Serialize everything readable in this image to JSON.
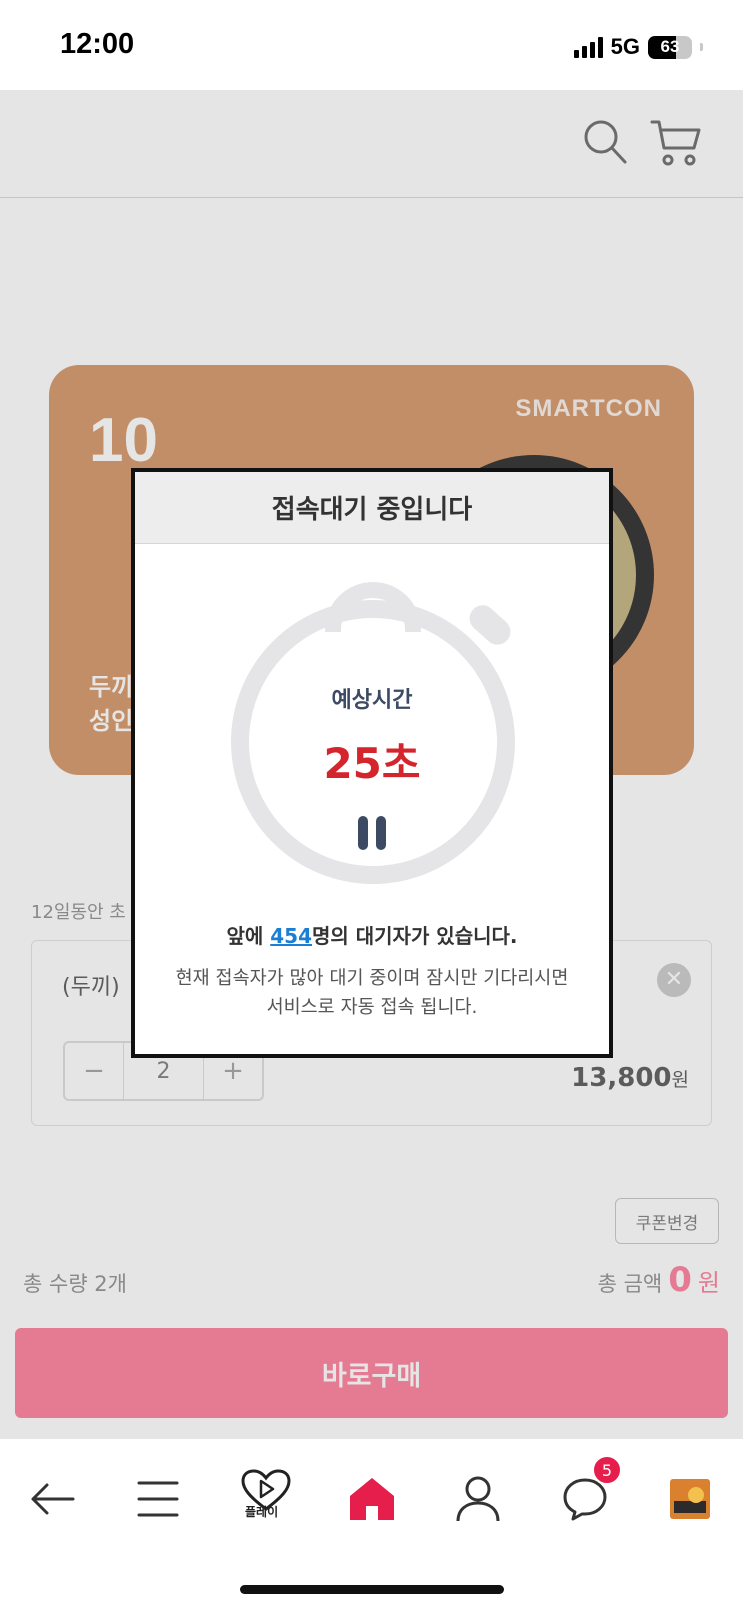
{
  "status_bar": {
    "time": "12:00",
    "network": "5G",
    "battery": "63",
    "battery_level": 0.63
  },
  "header": {
    "icons": [
      "search-icon",
      "cart-icon"
    ]
  },
  "product_card": {
    "badge": "10",
    "brand": "SMARTCON",
    "line1": "두끼",
    "line2": "성인"
  },
  "sheet": {
    "subtitle": "12일동안 초",
    "option": {
      "name": "(두끼)",
      "quantity": "2",
      "price": "13,800",
      "currency": "원"
    },
    "coupon_button": "쿠폰변경",
    "total_quantity": "총 수량 2개",
    "total_amount_label": "총 금액",
    "total_amount": "0",
    "total_currency": "원",
    "buy_button": "바로구매"
  },
  "modal": {
    "title": "접속대기 중입니다",
    "wait_label": "예상시간",
    "wait_time": "25초",
    "queue_prefix": "앞에 ",
    "queue_count": "454",
    "queue_suffix": "명의 대기자가 있습니다.",
    "notice_line1": "현재 접속자가 많아 대기 중이며 잠시만 기다리시면",
    "notice_line2": "서비스로 자동 접속 됩니다."
  },
  "bottom_nav": {
    "items": [
      "back-icon",
      "menu-icon",
      "play-icon",
      "home-icon",
      "profile-icon",
      "chat-icon",
      "recent-product-icon"
    ],
    "play_label": "플레이",
    "chat_badge": "5"
  },
  "colors": {
    "accent_pink": "#ff8aa3",
    "home_red": "#e61e4b",
    "wait_red": "#d4242c",
    "link_blue": "#1a7fd4",
    "card_orange": "#d99f74"
  }
}
